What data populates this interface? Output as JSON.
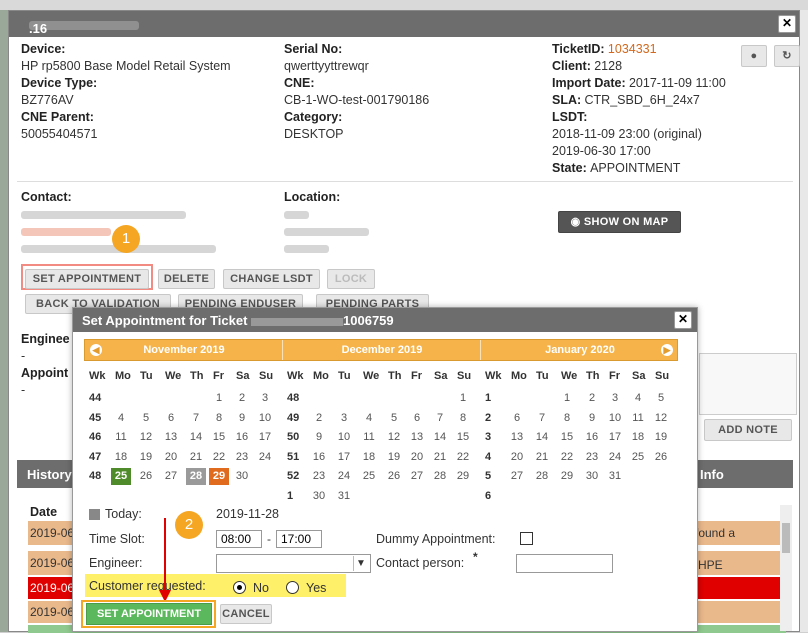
{
  "outer": {
    "title_suffix": ".16 7",
    "device_label": "Device:",
    "device_value": "HP rp5800 Base Model Retail System",
    "device_type_label": "Device Type:",
    "device_type_value": "BZ776AV",
    "cne_parent_label": "CNE Parent:",
    "cne_parent_value": "50055404571",
    "serial_label": "Serial No:",
    "serial_value": "qwerttyyttrewqr",
    "cne_label": "CNE:",
    "cne_value": "CB-1-WO-test-001790186",
    "category_label": "Category:",
    "category_value": "DESKTOP",
    "ticketid_label": "TicketID:",
    "ticketid_value": "1034331",
    "client_label": "Client:",
    "client_value": "2128",
    "import_label": "Import Date:",
    "import_value": "2017-11-09 11:00",
    "sla_label": "SLA:",
    "sla_value": "CTR_SBD_6H_24x7",
    "lsdt_label": "LSDT:",
    "lsdt_value1": "2018-11-09 23:00 (original)",
    "lsdt_value2": "2019-06-30 17:00",
    "state_label": "State:",
    "state_value": "APPOINTMENT",
    "contact_label": "Contact:",
    "location_label": "Location:",
    "show_map": "SHOW ON MAP",
    "buttons": [
      "SET APPOINTMENT",
      "DELETE",
      "CHANGE LSDT",
      "LOCK",
      "BACK TO VALIDATION",
      "PENDING ENDUSER",
      "PENDING PARTS"
    ],
    "engineer_label": "Enginee",
    "engineer_dash": "-",
    "appoint_label": "Appoint",
    "appoint_dash": "-",
    "add_note": "ADD NOTE",
    "history_tab": "History",
    "info_tab": "Info",
    "date_header": "Date",
    "history_rows": [
      "2019-06",
      "2019-06",
      "2019-06",
      "2019-06",
      "2019-06"
    ],
    "note1": "n) found a",
    "note2": "h HPE",
    "step1": "1",
    "step2": "2"
  },
  "dialog": {
    "title": "Set Appointment for Ticket",
    "title_suffix": "1006759",
    "months": [
      "November 2019",
      "December 2019",
      "January 2020"
    ],
    "weekday_headers": [
      "Wk",
      "Mo",
      "Tu",
      "We",
      "Th",
      "Fr",
      "Sa",
      "Su"
    ],
    "today_label": "Today:",
    "today_value": "2019-11-28",
    "timeslot_label": "Time Slot:",
    "time_from": "08:00",
    "time_sep": "-",
    "time_to": "17:00",
    "dummy_label": "Dummy Appointment:",
    "engineer_label": "Engineer:",
    "contact_person_label": "Contact person:",
    "required_mark": "*",
    "customer_requested_label": "Customer requested:",
    "no_label": "No",
    "yes_label": "Yes",
    "set_btn": "SET APPOINTMENT",
    "cancel_btn": "CANCEL"
  },
  "calendars": [
    {
      "rows": [
        {
          "wk": "44",
          "days": [
            "",
            "",
            "",
            "",
            "1",
            "2",
            "3"
          ]
        },
        {
          "wk": "45",
          "days": [
            "4",
            "5",
            "6",
            "7",
            "8",
            "9",
            "10"
          ]
        },
        {
          "wk": "46",
          "days": [
            "11",
            "12",
            "13",
            "14",
            "15",
            "16",
            "17"
          ]
        },
        {
          "wk": "47",
          "days": [
            "18",
            "19",
            "20",
            "21",
            "22",
            "23",
            "24"
          ]
        },
        {
          "wk": "48",
          "days": [
            "25",
            "26",
            "27",
            "28",
            "29",
            "30",
            ""
          ]
        }
      ]
    },
    {
      "rows": [
        {
          "wk": "48",
          "days": [
            "",
            "",
            "",
            "",
            "",
            "",
            "1"
          ]
        },
        {
          "wk": "49",
          "days": [
            "2",
            "3",
            "4",
            "5",
            "6",
            "7",
            "8"
          ]
        },
        {
          "wk": "50",
          "days": [
            "9",
            "10",
            "11",
            "12",
            "13",
            "14",
            "15"
          ]
        },
        {
          "wk": "51",
          "days": [
            "16",
            "17",
            "18",
            "19",
            "20",
            "21",
            "22"
          ]
        },
        {
          "wk": "52",
          "days": [
            "23",
            "24",
            "25",
            "26",
            "27",
            "28",
            "29"
          ]
        },
        {
          "wk": "1",
          "days": [
            "30",
            "31",
            "",
            "",
            "",
            "",
            ""
          ]
        }
      ]
    },
    {
      "rows": [
        {
          "wk": "1",
          "days": [
            "",
            "",
            "1",
            "2",
            "3",
            "4",
            "5"
          ]
        },
        {
          "wk": "2",
          "days": [
            "6",
            "7",
            "8",
            "9",
            "10",
            "11",
            "12"
          ]
        },
        {
          "wk": "3",
          "days": [
            "13",
            "14",
            "15",
            "16",
            "17",
            "18",
            "19"
          ]
        },
        {
          "wk": "4",
          "days": [
            "20",
            "21",
            "22",
            "23",
            "24",
            "25",
            "26"
          ]
        },
        {
          "wk": "5",
          "days": [
            "27",
            "28",
            "29",
            "30",
            "31",
            "",
            ""
          ]
        },
        {
          "wk": "6",
          "days": [
            "",
            "",
            "",
            "",
            "",
            "",
            ""
          ]
        }
      ]
    }
  ]
}
